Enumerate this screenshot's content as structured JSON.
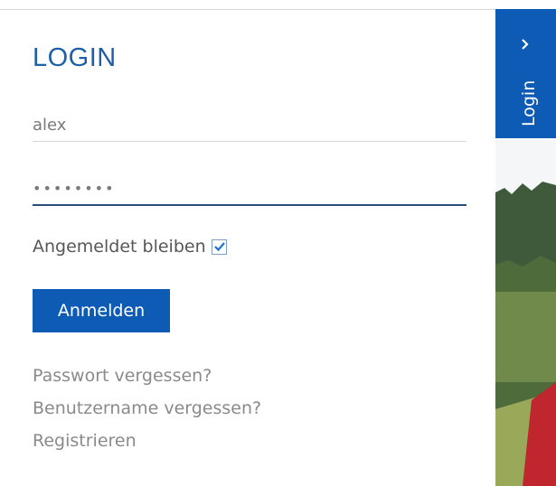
{
  "login": {
    "title": "LOGIN",
    "username_value": "alex",
    "password_value": "••••••••",
    "remember_label": "Angemeldet bleiben",
    "remember_checked": true,
    "submit_label": "Anmelden",
    "links": [
      "Passwort vergessen?",
      "Benutzername vergessen?",
      "Registrieren"
    ]
  },
  "side_tab": {
    "label": "Login",
    "icon": "chevron-right-icon"
  },
  "colors": {
    "accent": "#0d5bb5",
    "title": "#1d5fa8",
    "link": "#8a8a8a"
  }
}
